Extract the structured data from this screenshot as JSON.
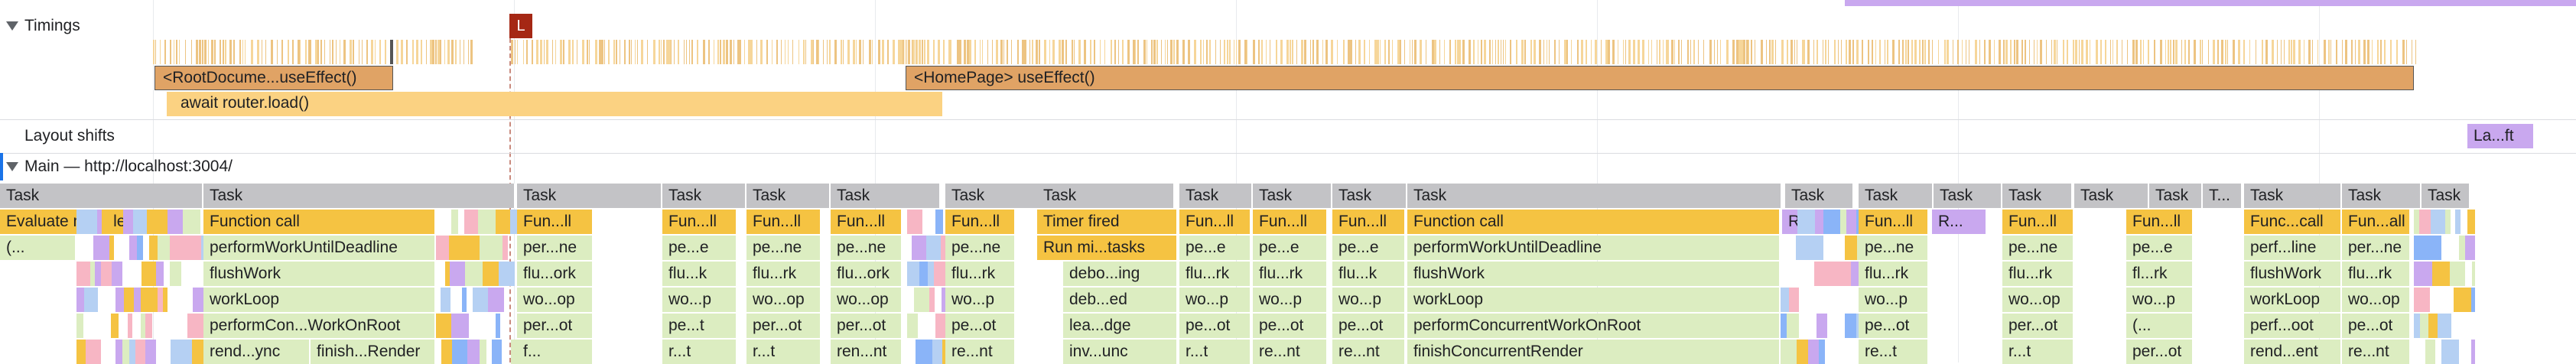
{
  "tracks": {
    "timings_label": "Timings",
    "layout_shifts_label": "Layout shifts",
    "main_label": "Main — http://localhost:3004/"
  },
  "markers": {
    "lcp_label": "L",
    "layout_shift_cluster": "La...ft"
  },
  "timings": {
    "root_effect": "<RootDocume...useEffect()",
    "homepage_effect": "<HomePage> useEffect()",
    "router_load": "await router.load()"
  },
  "colors": {
    "task": "#c3c3c6",
    "script": "#f5c342",
    "js_frame": "#dcedc1",
    "render": "#c9a8ef",
    "timing_dark": "#e0a365",
    "timing_light": "#fbd282",
    "lcp_marker": "#a52714"
  },
  "flame": {
    "task_row": [
      "Task",
      "Task",
      "Task",
      "Task",
      "Task",
      "Task",
      "Task",
      "Task",
      "Task",
      "Task",
      "Task",
      "Task",
      "Task",
      "Task",
      "Task",
      "Task",
      "Task",
      "Task",
      "T...",
      "Task",
      "Task",
      "Task"
    ],
    "row1": [
      "Evaluate module",
      "Function call",
      "Fun...ll",
      "Fun...ll",
      "Fun...ll",
      "Fun...ll",
      "Fun...ll",
      "Timer fired",
      "Fun...ll",
      "Fun...ll",
      "Fun...ll",
      "Function call",
      "R...",
      "Fun...ll",
      "R...",
      "Fun...ll",
      "Fun...ll",
      "Func...call",
      "Fun...all"
    ],
    "row2": [
      "(...",
      "performWorkUntilDeadline",
      "per...ne",
      "pe...e",
      "pe...ne",
      "pe...ne",
      "pe...ne",
      "Run mi...tasks",
      "pe...e",
      "pe...e",
      "pe...e",
      "performWorkUntilDeadline",
      "pe...ne",
      "pe...ne",
      "pe...e",
      "perf...line",
      "per...ne"
    ],
    "row3": [
      "flushWork",
      "flu...ork",
      "flu...k",
      "flu...rk",
      "flu...ork",
      "flu...rk",
      "debo...ing",
      "flu...rk",
      "flu...rk",
      "flu...k",
      "flushWork",
      "flu...rk",
      "flu...rk",
      "fl...rk",
      "flushWork",
      "flu...rk"
    ],
    "row4": [
      "workLoop",
      "wo...op",
      "wo...p",
      "wo...op",
      "wo...op",
      "wo...p",
      "deb...ed",
      "wo...p",
      "wo...p",
      "wo...p",
      "workLoop",
      "wo...p",
      "wo...op",
      "wo...p",
      "workLoop",
      "wo...op"
    ],
    "row5": [
      "performCon...WorkOnRoot",
      "per...ot",
      "pe...t",
      "per...ot",
      "per...ot",
      "pe...ot",
      "lea...dge",
      "pe...ot",
      "pe...ot",
      "pe...ot",
      "performConcurrentWorkOnRoot",
      "pe...ot",
      "per...ot",
      "(...",
      "perf...oot",
      "pe...ot"
    ],
    "row6": [
      "rend...ync",
      "finish...Render",
      "f...",
      "r...t",
      "r...t",
      "ren...nt",
      "re...nt",
      "inv...unc",
      "r...t",
      "re...nt",
      "re...nt",
      "finishConcurrentRender",
      "re...t",
      "r...t",
      "per...ot",
      "rend...ent",
      "re...nt"
    ]
  }
}
